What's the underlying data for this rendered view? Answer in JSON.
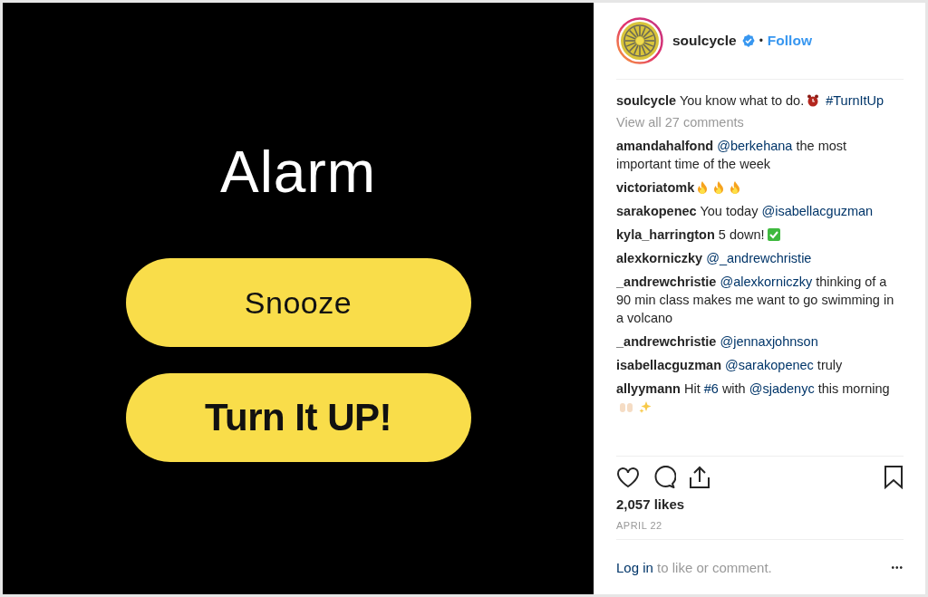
{
  "post_image": {
    "title": "Alarm",
    "buttons": [
      {
        "label": "Snooze",
        "kind": "regular"
      },
      {
        "label": "Turn It UP!",
        "kind": "bold"
      }
    ]
  },
  "header": {
    "username": "soulcycle",
    "verified": true,
    "follow": "Follow",
    "separator": "•"
  },
  "caption": {
    "user": "soulcycle",
    "parts": [
      {
        "kind": "text",
        "text": "You know what to do."
      },
      {
        "kind": "alarm"
      },
      {
        "kind": "hashtag",
        "text": "#TurnItUp"
      }
    ]
  },
  "view_all": "View all 27 comments",
  "comments": [
    {
      "user": "amandahalfond",
      "parts": [
        {
          "kind": "mention",
          "text": "@berkehana"
        },
        {
          "kind": "text",
          "text": "the most important time of the week"
        }
      ]
    },
    {
      "user": "victoriatomk",
      "parts": [
        {
          "kind": "fire"
        },
        {
          "kind": "fire"
        },
        {
          "kind": "fire"
        }
      ]
    },
    {
      "user": "sarakopenec",
      "parts": [
        {
          "kind": "text",
          "text": "You today"
        },
        {
          "kind": "mention",
          "text": "@isabellacguzman"
        }
      ]
    },
    {
      "user": "kyla_harrington",
      "parts": [
        {
          "kind": "text",
          "text": "5 down!"
        },
        {
          "kind": "check"
        }
      ]
    },
    {
      "user": "alexkorniczky",
      "parts": [
        {
          "kind": "mention",
          "text": "@_andrewchristie"
        }
      ]
    },
    {
      "user": "_andrewchristie",
      "parts": [
        {
          "kind": "mention",
          "text": "@alexkorniczky"
        },
        {
          "kind": "text",
          "text": "thinking of a 90 min class makes me want to go swimming in a volcano"
        }
      ]
    },
    {
      "user": "_andrewchristie",
      "parts": [
        {
          "kind": "mention",
          "text": "@jennaxjohnson"
        }
      ]
    },
    {
      "user": "isabellacguzman",
      "parts": [
        {
          "kind": "mention",
          "text": "@sarakopenec"
        },
        {
          "kind": "text",
          "text": "truly"
        }
      ]
    },
    {
      "user": "allyymann",
      "parts": [
        {
          "kind": "text",
          "text": "Hit"
        },
        {
          "kind": "hashtag",
          "text": "#6"
        },
        {
          "kind": "text",
          "text": "with"
        },
        {
          "kind": "mention",
          "text": "@sjadenyc"
        },
        {
          "kind": "text",
          "text": "this morning"
        },
        {
          "kind": "hands"
        },
        {
          "kind": "sparkles"
        }
      ]
    }
  ],
  "likes": "2,057 likes",
  "date": "APRIL 22",
  "login": {
    "link": "Log in",
    "text": "to like or comment."
  },
  "more": "•••"
}
